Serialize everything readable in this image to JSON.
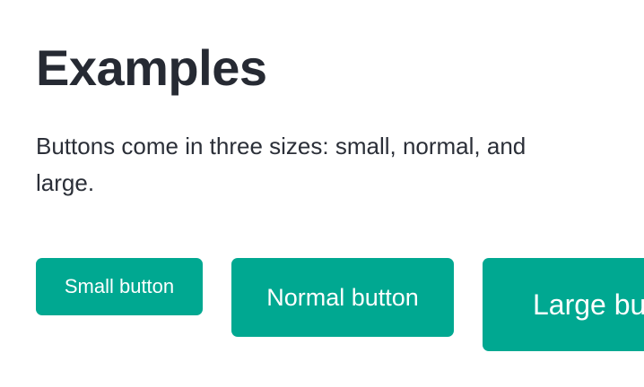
{
  "heading": "Examples",
  "description": "Buttons come in three sizes: small, normal, and large.",
  "buttons": {
    "small_label": "Small button",
    "normal_label": "Normal button",
    "large_label": "Large button"
  },
  "colors": {
    "button_bg": "#00a891",
    "button_text": "#ffffff",
    "heading_text": "#262a33"
  }
}
